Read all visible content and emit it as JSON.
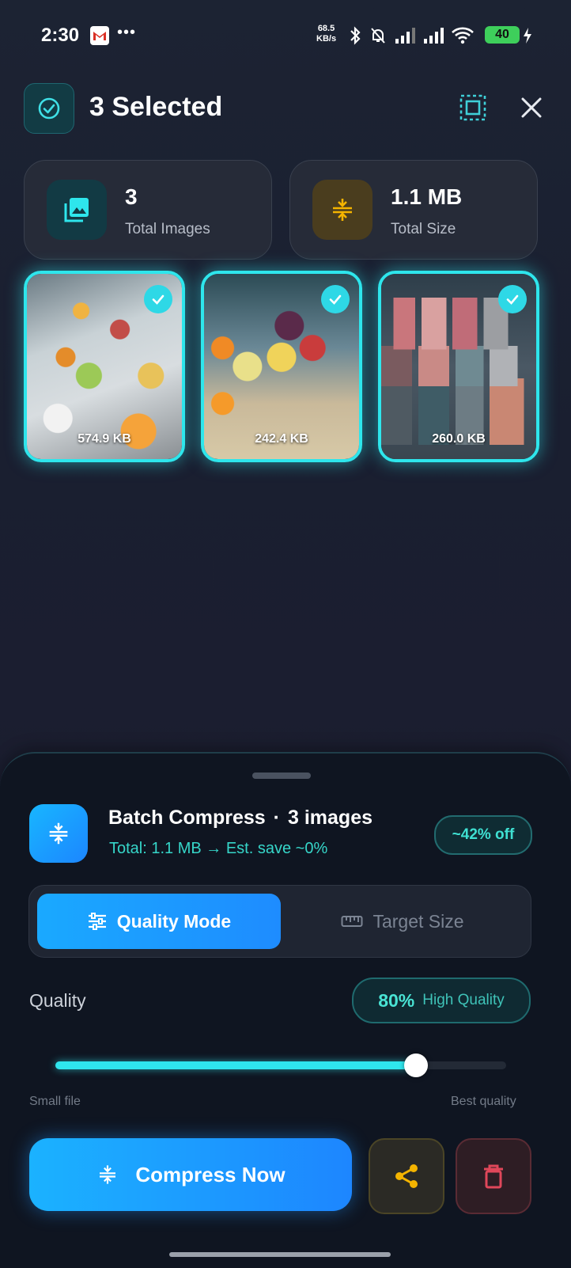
{
  "status_bar": {
    "time": "2:30",
    "net_speed_value": "68.5",
    "net_speed_unit": "KB/s",
    "battery": "40"
  },
  "header": {
    "title": "3 Selected"
  },
  "summary": {
    "images_value": "3",
    "images_label": "Total Images",
    "size_value": "1.1 MB",
    "size_label": "Total Size"
  },
  "thumbnails": [
    {
      "size": "574.9 KB",
      "selected": true
    },
    {
      "size": "242.4 KB",
      "selected": true
    },
    {
      "size": "260.0 KB",
      "selected": true
    }
  ],
  "sheet": {
    "title": "Batch Compress",
    "separator": "·",
    "count": "3 images",
    "subtitle": "Total: 1.1 MB  →  Est. save ~0%",
    "discount": "~42% off",
    "modes": {
      "active": "Quality Mode",
      "other": "Target Size"
    },
    "quality_label": "Quality",
    "quality_percent": "80%",
    "quality_text": "High Quality",
    "slider_fraction": 0.8,
    "hint_left": "Small file",
    "hint_right": "Best quality",
    "compress_label": "Compress Now"
  },
  "colors": {
    "accent_cyan": "#2ee6ec",
    "button_blue": "#1d8cff",
    "share_yellow": "#f4b400",
    "delete_red": "#e0475a"
  }
}
